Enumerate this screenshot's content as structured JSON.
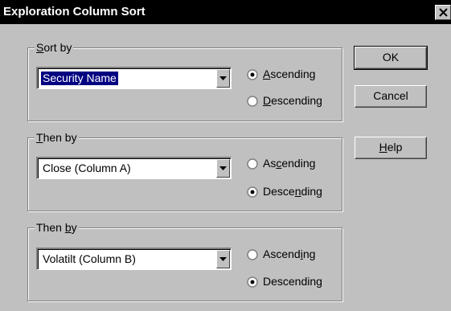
{
  "window": {
    "title": "Exploration Column Sort",
    "close_icon": "close-x"
  },
  "groups": [
    {
      "legend_pre": "",
      "legend_key": "S",
      "legend_post": "ort by",
      "combo_value": "Security Name",
      "combo_focused": true,
      "ascending": {
        "pre": "",
        "key": "A",
        "post": "scending",
        "checked": true
      },
      "descending": {
        "pre": "",
        "key": "D",
        "post": "escending",
        "checked": false
      }
    },
    {
      "legend_pre": "",
      "legend_key": "T",
      "legend_post": "hen by",
      "combo_value": "Close (Column A)",
      "combo_focused": false,
      "ascending": {
        "pre": "As",
        "key": "c",
        "post": "ending",
        "checked": false
      },
      "descending": {
        "pre": "Desce",
        "key": "n",
        "post": "ding",
        "checked": true
      }
    },
    {
      "legend_pre": "Then ",
      "legend_key": "b",
      "legend_post": "y",
      "combo_value": "Volatilt (Column B)",
      "combo_focused": false,
      "ascending": {
        "pre": "Ascend",
        "key": "i",
        "post": "ng",
        "checked": false
      },
      "descending": {
        "pre": "Descendin",
        "key": "g",
        "post": "",
        "checked": true
      }
    }
  ],
  "buttons": {
    "ok": "OK",
    "cancel": "Cancel",
    "help_key": "H",
    "help_post": "elp"
  },
  "colors": {
    "face": "#c0c0c0",
    "titlebar": "#000000",
    "selection": "#000080"
  }
}
